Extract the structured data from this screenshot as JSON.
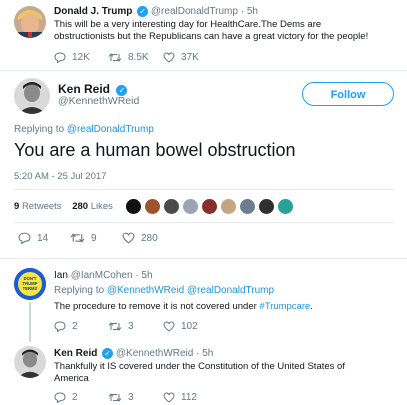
{
  "tweet1": {
    "name": "Donald J. Trump",
    "handle": "@realDonaldTrump",
    "time": "· 5h",
    "text": "This will be a very interesting day for HealthCare.The Dems are obstructionists but the Republicans can have a great victory for the people!",
    "replies": "12K",
    "retweets": "8.5K",
    "likes": "37K"
  },
  "main": {
    "name": "Ken Reid",
    "handle": "@KennethWReid",
    "follow_label": "Follow",
    "replying_prefix": "Replying to ",
    "replying_to": "@realDonaldTrump",
    "text": "You are a human bowel obstruction",
    "timestamp": "5:20 AM - 25 Jul 2017",
    "retweets_count": "9",
    "retweets_label": "Retweets",
    "likes_count": "280",
    "likes_label": "Likes",
    "replies": "14",
    "retweets": "9",
    "likes": "280"
  },
  "reply1": {
    "name": "Ian",
    "handle": "@IanMCohen",
    "time": "· 5h",
    "replying_prefix": "Replying to ",
    "replying_to": "@KennethWReid @realDonaldTrump",
    "text_before": "The procedure to remove it is not covered under ",
    "hashtag": "#Trumpcare",
    "text_after": ".",
    "avatar_text": "DON'T YOU TRUMP ON HIS TERMS",
    "replies": "2",
    "retweets": "3",
    "likes": "102"
  },
  "reply2": {
    "name": "Ken Reid",
    "handle": "@KennethWReid",
    "time": "· 5h",
    "text": "Thankfully it IS covered under the Constitution of the United States of America",
    "replies": "2",
    "retweets": "3",
    "likes": "112"
  },
  "colors": {
    "accent": "#1da1f2",
    "link": "#1b95e0",
    "muted": "#657786"
  }
}
